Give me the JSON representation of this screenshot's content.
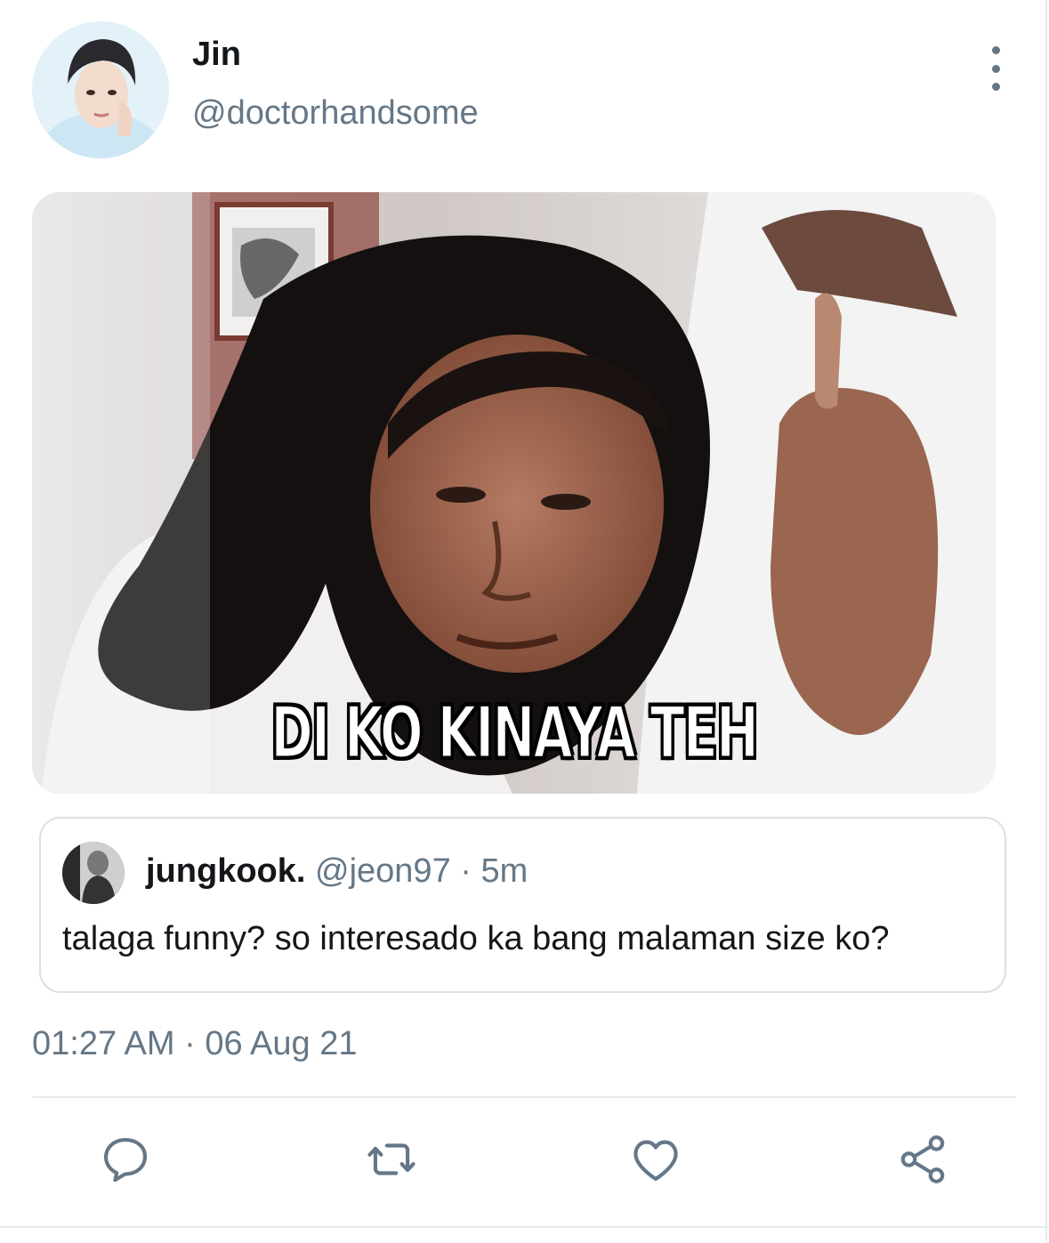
{
  "tweet": {
    "author": {
      "display_name": "Jin",
      "handle": "@doctorhandsome"
    },
    "media": {
      "caption": "DI KO KINAYA TEH"
    },
    "quoted_tweet": {
      "display_name": "jungkook.",
      "handle": "@jeon97",
      "separator": "·",
      "time": "5m",
      "text": "talaga funny? so interesado ka bang malaman size ko?"
    },
    "timestamp": "01:27 AM · 06 Aug 21"
  },
  "actions": [
    {
      "icon": "reply-icon"
    },
    {
      "icon": "retweet-icon"
    },
    {
      "icon": "like-icon"
    },
    {
      "icon": "share-icon"
    }
  ],
  "colors": {
    "primary_text": "#14171a",
    "secondary_text": "#657786",
    "border": "#d9e1e7",
    "icon": "#657786"
  }
}
